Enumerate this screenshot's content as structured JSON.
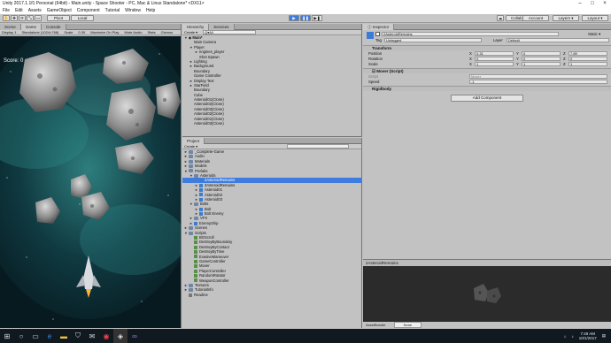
{
  "window": {
    "title": "Unity 2017.1.1f1 Personal (64bit) - Main.unity - Space Shooter - PC, Mac & Linux Standalone* <DX11>"
  },
  "menu": [
    "File",
    "Edit",
    "Assets",
    "GameObject",
    "Component",
    "Tutorial",
    "Window",
    "Help"
  ],
  "toolbar": {
    "pivot": "Pivot",
    "local": "Local",
    "collab": "Collab ▾",
    "account": "Account",
    "layers": "Layers",
    "layout": "Layout"
  },
  "game": {
    "tabs": [
      "Scene",
      "Game",
      "Console"
    ],
    "display": "Display 1",
    "aspect": "Standalone (1024×768)",
    "scale_label": "Scale",
    "scale_value": "0.30",
    "maximize": "Maximize On Play",
    "mute": "Mute Audio",
    "stats": "Stats",
    "gizmos": "Gizmos",
    "score": "Score: 0"
  },
  "hierarchy": {
    "tab": "Hierarchy",
    "services_tab": "Services",
    "create": "Create ▾",
    "search_prefix": "Q▾All",
    "scene": "Main*",
    "items": [
      {
        "label": "Main Camera",
        "indent": 1,
        "arrow": ""
      },
      {
        "label": "Player",
        "indent": 1,
        "arrow": "▼"
      },
      {
        "label": "engines_player",
        "indent": 2,
        "arrow": "►"
      },
      {
        "label": "Shot Spawn",
        "indent": 2,
        "arrow": ""
      },
      {
        "label": "Lighting",
        "indent": 1,
        "arrow": "►"
      },
      {
        "label": "Background",
        "indent": 1,
        "arrow": "►"
      },
      {
        "label": "Boundary",
        "indent": 1,
        "arrow": ""
      },
      {
        "label": "Game Controller",
        "indent": 1,
        "arrow": ""
      },
      {
        "label": "Display Text",
        "indent": 1,
        "arrow": "►"
      },
      {
        "label": "StarField",
        "indent": 1,
        "arrow": "►"
      },
      {
        "label": "Boundary",
        "indent": 1,
        "arrow": ""
      },
      {
        "label": "Cube",
        "indent": 1,
        "arrow": ""
      },
      {
        "label": "Asteroid01(Clone)",
        "indent": 1,
        "arrow": ""
      },
      {
        "label": "Asteroid02(Clone)",
        "indent": 1,
        "arrow": ""
      },
      {
        "label": "Asteroid03(Clone)",
        "indent": 1,
        "arrow": ""
      },
      {
        "label": "Asteroid02(Clone)",
        "indent": 1,
        "arrow": ""
      },
      {
        "label": "Asteroid01(Clone)",
        "indent": 1,
        "arrow": ""
      },
      {
        "label": "Asteroid03(Clone)",
        "indent": 1,
        "arrow": ""
      }
    ]
  },
  "project": {
    "tab": "Project",
    "create": "Create ▾",
    "items": [
      {
        "label": "_Complete-Game",
        "indent": 0,
        "icon": "folder",
        "arrow": "►",
        "sel": false
      },
      {
        "label": "Audio",
        "indent": 0,
        "icon": "folder",
        "arrow": "►",
        "sel": false
      },
      {
        "label": "Materials",
        "indent": 0,
        "icon": "folder",
        "arrow": "►",
        "sel": false
      },
      {
        "label": "Models",
        "indent": 0,
        "icon": "folder",
        "arrow": "►",
        "sel": false
      },
      {
        "label": "Prefabs",
        "indent": 0,
        "icon": "folder",
        "arrow": "▼",
        "sel": false
      },
      {
        "label": "Asteroids",
        "indent": 1,
        "icon": "folder",
        "arrow": "▼",
        "sel": false
      },
      {
        "label": "2AsteroidRemains",
        "indent": 2,
        "icon": "cube",
        "arrow": "",
        "sel": true
      },
      {
        "label": "3AsteroidRemains",
        "indent": 2,
        "icon": "cube",
        "arrow": "►",
        "sel": false
      },
      {
        "label": "Asteroid01",
        "indent": 2,
        "icon": "cube",
        "arrow": "►",
        "sel": false
      },
      {
        "label": "Asteroid02",
        "indent": 2,
        "icon": "cube",
        "arrow": "►",
        "sel": false
      },
      {
        "label": "Asteroid03",
        "indent": 2,
        "icon": "cube",
        "arrow": "►",
        "sel": false
      },
      {
        "label": "Bolts",
        "indent": 1,
        "icon": "folder",
        "arrow": "▼",
        "sel": false
      },
      {
        "label": "Bolt",
        "indent": 2,
        "icon": "cube",
        "arrow": "►",
        "sel": false
      },
      {
        "label": "Bolt Enemy",
        "indent": 2,
        "icon": "cube",
        "arrow": "►",
        "sel": false
      },
      {
        "label": "VFX",
        "indent": 1,
        "icon": "folder",
        "arrow": "►",
        "sel": false
      },
      {
        "label": "EnemyShip",
        "indent": 1,
        "icon": "cube",
        "arrow": "►",
        "sel": false
      },
      {
        "label": "Scenes",
        "indent": 0,
        "icon": "folder",
        "arrow": "►",
        "sel": false
      },
      {
        "label": "Scripts",
        "indent": 0,
        "icon": "folder",
        "arrow": "▼",
        "sel": false
      },
      {
        "label": "BGScroll",
        "indent": 1,
        "icon": "script",
        "arrow": "",
        "sel": false
      },
      {
        "label": "DestroyByBoundary",
        "indent": 1,
        "icon": "script",
        "arrow": "",
        "sel": false
      },
      {
        "label": "DestroyByContact",
        "indent": 1,
        "icon": "script",
        "arrow": "",
        "sel": false
      },
      {
        "label": "DestroyByTime",
        "indent": 1,
        "icon": "script",
        "arrow": "",
        "sel": false
      },
      {
        "label": "EvasiveManeuver",
        "indent": 1,
        "icon": "script",
        "arrow": "",
        "sel": false
      },
      {
        "label": "GameController",
        "indent": 1,
        "icon": "script",
        "arrow": "",
        "sel": false
      },
      {
        "label": "Mover",
        "indent": 1,
        "icon": "script",
        "arrow": "",
        "sel": false
      },
      {
        "label": "PlayerController",
        "indent": 1,
        "icon": "script",
        "arrow": "",
        "sel": false
      },
      {
        "label": "RandomRotator",
        "indent": 1,
        "icon": "script",
        "arrow": "",
        "sel": false
      },
      {
        "label": "WeaponController",
        "indent": 1,
        "icon": "script",
        "arrow": "",
        "sel": false
      },
      {
        "label": "Textures",
        "indent": 0,
        "icon": "folder",
        "arrow": "►",
        "sel": false
      },
      {
        "label": "TutorialInfo",
        "indent": 0,
        "icon": "folder",
        "arrow": "►",
        "sel": false
      },
      {
        "label": "Readme",
        "indent": 0,
        "icon": "readme",
        "arrow": "",
        "sel": false
      }
    ]
  },
  "inspector": {
    "tab": "Inspector",
    "object_name": "2AsteroidRemains",
    "static": "Static ▾",
    "tag_label": "Tag",
    "tag": "Untagged",
    "layer_label": "Layer",
    "layer": "Default",
    "prefab_label": "Prefab",
    "prefab_buttons": [
      "Select",
      "Revert",
      "Apply"
    ],
    "transform": {
      "title": "Transform",
      "rows": [
        {
          "label": "Position",
          "x": "0.31",
          "y": "0",
          "z": "7.89"
        },
        {
          "label": "Rotation",
          "x": "0",
          "y": "0",
          "z": "0"
        },
        {
          "label": "Scale",
          "x": "1",
          "y": "1",
          "z": "1"
        }
      ]
    },
    "mover": {
      "title": "Mover (Script)",
      "script_label": "Script",
      "script": "Mover",
      "speed_label": "Speed",
      "speed": "-1"
    },
    "rigidbody": {
      "title": "Rigidbody"
    },
    "add_component": "Add Component"
  },
  "preview": {
    "title": "2AsteroidRemains",
    "footer_left": "AssetBundle",
    "footer_value": "None"
  },
  "taskbar": {
    "time": "7:49 AM",
    "date": "10/1/2017"
  }
}
